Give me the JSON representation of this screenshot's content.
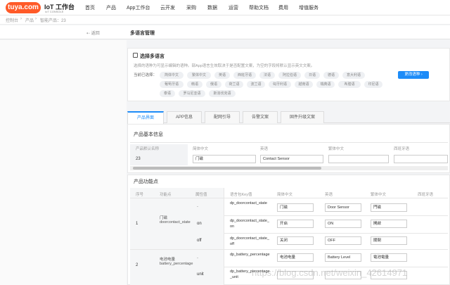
{
  "logo_text": "tuya.com",
  "brand": {
    "title": "IoT 工作台",
    "subtitle": "IoT CONSOLE"
  },
  "nav": [
    "首页",
    "产品",
    "App工作台",
    "云开发",
    "采购",
    "数据",
    "运营",
    "帮助文档",
    "费用",
    "增值服务"
  ],
  "breadcrumb": {
    "home": "控制台",
    "sep1": "›",
    "product": "产品",
    "sep2": "›",
    "current": "智能产品：23"
  },
  "subheader": {
    "back": "⇠ 返回",
    "title": "多语言管理"
  },
  "lang_card": {
    "title": "选择多语言",
    "desc": "选择的语种为可显示编辑的语种。部App语言生效取决于是否配置文案，为空的字段将默认显示英文文案。",
    "current_label": "当前已选择：",
    "languages": [
      "简体中文",
      "繁体中文",
      "英语",
      "西班牙语",
      "法语",
      "阿拉伯语",
      "日语",
      "德语",
      "意大利语",
      "葡萄牙语",
      "韩语",
      "俄语",
      "荷兰语",
      "波兰语",
      "匈牙利语",
      "越南语",
      "瑞典语",
      "希腊语",
      "印尼语",
      "泰语",
      "罗马尼亚语",
      "斯洛伐克语"
    ],
    "switch_button": "更改语种 ›"
  },
  "tabs": [
    "产品界面",
    "APP信息",
    "配网引导",
    "告警文案",
    "固件升级文案"
  ],
  "basic_info": {
    "title": "产品基本信息",
    "headers": [
      "产品默认名称",
      "简体中文",
      "英语",
      "繁体中文",
      "西班牙语"
    ],
    "row": {
      "default_name": "23",
      "zh_cn": "门磁",
      "en": "Contact Sensor",
      "zh_tw": "",
      "es": ""
    }
  },
  "functions": {
    "title": "产品功能点",
    "headers": [
      "序号",
      "功能点",
      "属性值",
      "语言包Key值",
      "简体中文",
      "英语",
      "繁体中文",
      "西班牙语"
    ],
    "groups": [
      {
        "index": "1",
        "name": "门磁\ndoorcontact_state",
        "rows": [
          {
            "attr": "-",
            "key": "dp_doorcontact_state",
            "zh_cn": "门磁",
            "en": "Door Sensor",
            "zh_tw": "門磁"
          },
          {
            "attr": "on",
            "key": "dp_doorcontact_state_on",
            "zh_cn": "开启",
            "en": "ON",
            "zh_tw": "開啟"
          },
          {
            "attr": "off",
            "key": "dp_doorcontact_state_off",
            "zh_cn": "关闭",
            "en": "OFF",
            "zh_tw": "關閉"
          }
        ]
      },
      {
        "index": "2",
        "name": "电池电量\nbattery_percentage",
        "rows": [
          {
            "attr": "-",
            "key": "dp_battery_percentage",
            "zh_cn": "电池电量",
            "en": "Battery Level",
            "zh_tw": "電池電量"
          },
          {
            "attr": "unit",
            "key": "dp_battery_percentage_unit",
            "zh_cn": "",
            "en": "",
            "zh_tw": ""
          }
        ]
      }
    ]
  },
  "watermark": "https://blog.csdn.net/weixin_42614971",
  "colors": {
    "brand": "#ff5a28",
    "accent": "#1d8cf8"
  }
}
